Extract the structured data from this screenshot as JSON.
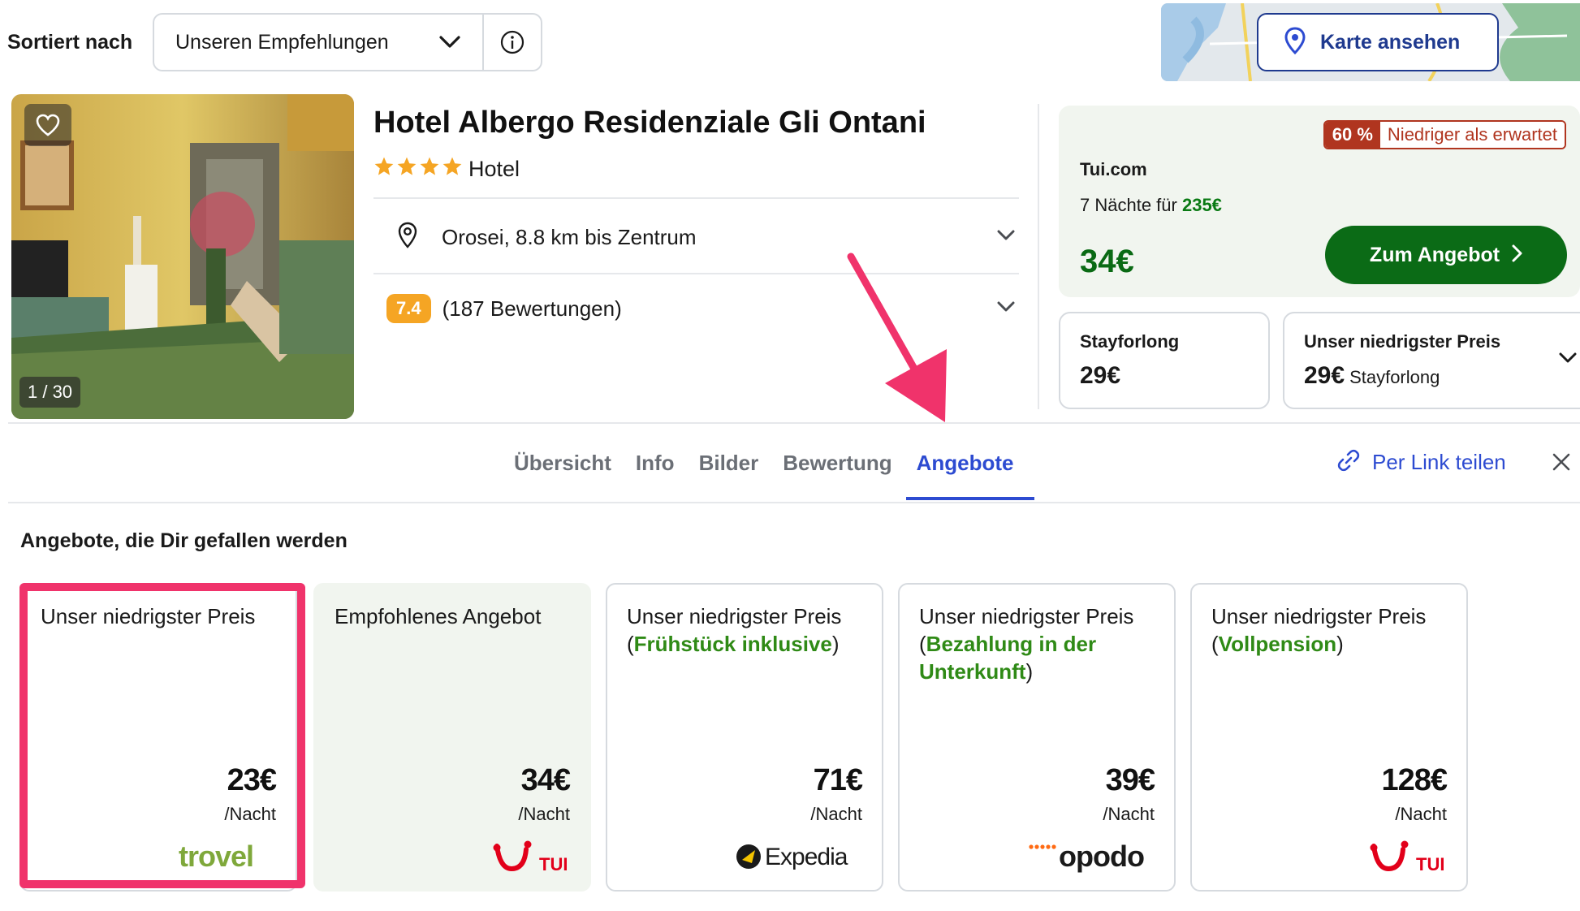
{
  "sort": {
    "label": "Sortiert nach",
    "value": "Unseren Empfehlungen"
  },
  "map": {
    "button_label": "Karte ansehen"
  },
  "hotel": {
    "name": "Hotel Albergo Residenziale Gli Ontani",
    "stars": 4,
    "type": "Hotel",
    "image_counter": "1 / 30",
    "location": "Orosei, 8.8 km bis Zentrum",
    "rating_score": "7.4",
    "rating_count": "(187 Bewertungen)"
  },
  "featured_deal": {
    "badge_pct": "60 %",
    "badge_text": "Niedriger als erwartet",
    "provider": "Tui.com",
    "nights_text": "7 Nächte für",
    "nights_total": "235€",
    "price": "34€",
    "cta_label": "Zum Angebot"
  },
  "alt_deals": [
    {
      "title": "Stayforlong",
      "price": "29€",
      "sub": ""
    },
    {
      "title": "Unser niedrigster Preis",
      "price": "29€",
      "sub": "Stayforlong"
    }
  ],
  "tabs": [
    {
      "label": "Übersicht",
      "active": false
    },
    {
      "label": "Info",
      "active": false
    },
    {
      "label": "Bilder",
      "active": false
    },
    {
      "label": "Bewertung",
      "active": false
    },
    {
      "label": "Angebote",
      "active": true
    }
  ],
  "share_label": "Per Link teilen",
  "offers_section": {
    "title": "Angebote, die Dir gefallen werden",
    "unit": "/Nacht",
    "offers": [
      {
        "label": "Unser niedrigster Preis",
        "label_open": "",
        "highlight": "",
        "label_close": "",
        "price": "23€",
        "provider": "trovel"
      },
      {
        "label": "Empfohlenes Angebot",
        "label_open": "",
        "highlight": "",
        "label_close": "",
        "price": "34€",
        "provider": "TUI"
      },
      {
        "label": "Unser niedrigster Preis",
        "label_open": "(",
        "highlight": "Frühstück inklusive",
        "label_close": ")",
        "price": "71€",
        "provider": "Expedia"
      },
      {
        "label": "Unser niedrigster Preis",
        "label_open": "(",
        "highlight": "Bezahlung in der Unterkunft",
        "label_close": ")",
        "price": "39€",
        "provider": "opodo"
      },
      {
        "label": "Unser niedrigster Preis",
        "label_open": "(",
        "highlight": "Vollpension",
        "label_close": ")",
        "price": "128€",
        "provider": "TUI"
      }
    ]
  },
  "colors": {
    "accent_blue": "#2d4bd1",
    "deal_green": "#0b6b16",
    "highlight_pink": "#f0336b",
    "badge_red": "#b0351f",
    "rating_orange": "#f5a524"
  }
}
